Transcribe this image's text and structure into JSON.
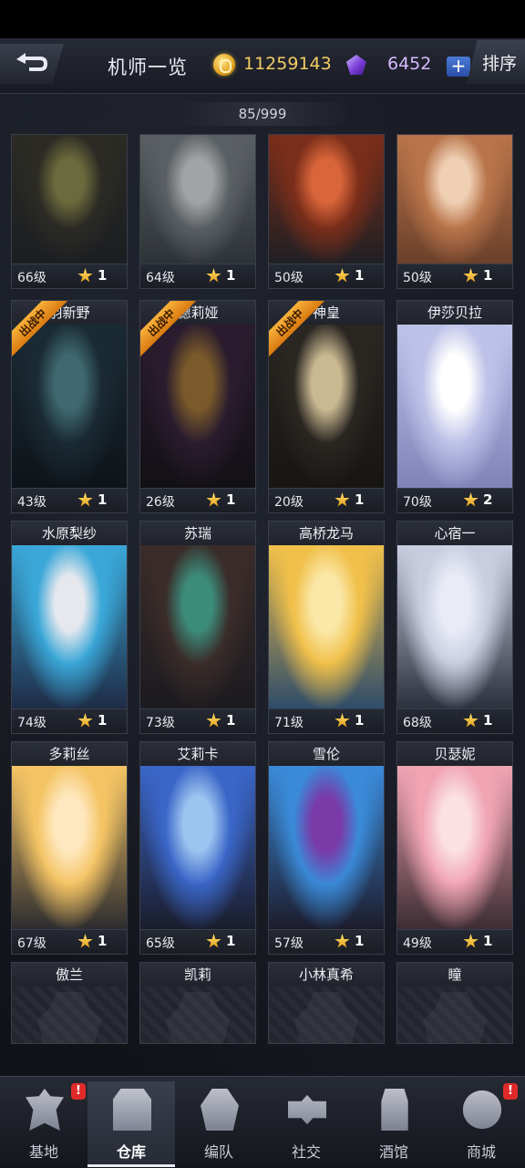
{
  "header": {
    "title": "机师一览",
    "coins": "11259143",
    "gems": "6452",
    "plus_label": "+",
    "sort_label": "排序"
  },
  "roster_count": "85/999",
  "badge_text": "出战中",
  "cards": [
    {
      "name": "",
      "level": "66级",
      "stars": "1",
      "deployed": false,
      "palette": [
        "#2b2a24",
        "#6b6a3c",
        "#1b1d22"
      ]
    },
    {
      "name": "",
      "level": "64级",
      "stars": "1",
      "deployed": false,
      "palette": [
        "#5a5f63",
        "#a0a4a6",
        "#2d3236"
      ]
    },
    {
      "name": "",
      "level": "50级",
      "stars": "1",
      "deployed": false,
      "palette": [
        "#7a2e1a",
        "#d9653a",
        "#1e1f24"
      ]
    },
    {
      "name": "",
      "level": "50级",
      "stars": "1",
      "deployed": false,
      "palette": [
        "#b8744a",
        "#f0d0b4",
        "#6a3f2a"
      ]
    },
    {
      "name": "羽新野",
      "level": "43级",
      "stars": "1",
      "deployed": true,
      "palette": [
        "#1a2a33",
        "#3f6870",
        "#0e1419"
      ]
    },
    {
      "name": "德莉娅",
      "level": "26级",
      "stars": "1",
      "deployed": true,
      "palette": [
        "#2a1c2e",
        "#7a5a2a",
        "#121015"
      ]
    },
    {
      "name": "神皇",
      "level": "20级",
      "stars": "1",
      "deployed": true,
      "palette": [
        "#2a2622",
        "#c9b890",
        "#171512"
      ]
    },
    {
      "name": "伊莎贝拉",
      "level": "70级",
      "stars": "2",
      "deployed": false,
      "palette": [
        "#bfc2e8",
        "#ffffff",
        "#7f82b8"
      ]
    },
    {
      "name": "水原梨纱",
      "level": "74级",
      "stars": "1",
      "deployed": false,
      "palette": [
        "#3aa7d8",
        "#e6e8ee",
        "#1e2a44"
      ]
    },
    {
      "name": "苏瑞",
      "level": "73级",
      "stars": "1",
      "deployed": false,
      "palette": [
        "#3a2c2a",
        "#3c8c7a",
        "#1b1a1f"
      ]
    },
    {
      "name": "高桥龙马",
      "level": "71级",
      "stars": "1",
      "deployed": false,
      "palette": [
        "#f0c04a",
        "#fbe8a8",
        "#2b4a6a"
      ]
    },
    {
      "name": "心宿一",
      "level": "68级",
      "stars": "1",
      "deployed": false,
      "palette": [
        "#c8cde0",
        "#e9ecf6",
        "#2a2e3a"
      ]
    },
    {
      "name": "多莉丝",
      "level": "67级",
      "stars": "1",
      "deployed": false,
      "palette": [
        "#f4c464",
        "#ffe8c0",
        "#2a2a2e"
      ]
    },
    {
      "name": "艾莉卡",
      "level": "65级",
      "stars": "1",
      "deployed": false,
      "palette": [
        "#3a66c8",
        "#9cc4f0",
        "#1a1c2a"
      ]
    },
    {
      "name": "雪伦",
      "level": "57级",
      "stars": "1",
      "deployed": false,
      "palette": [
        "#3a8ad8",
        "#7a3aa8",
        "#1c1a2a"
      ]
    },
    {
      "name": "贝瑟妮",
      "level": "49级",
      "stars": "1",
      "deployed": false,
      "palette": [
        "#f0a4b4",
        "#fbe0e4",
        "#3a2a30"
      ]
    }
  ],
  "locked_cards": [
    "傲兰",
    "凯莉",
    "小林真希",
    "瞳"
  ],
  "nav": [
    {
      "label": "基地",
      "alert": "!",
      "icon": "base-icon"
    },
    {
      "label": "仓库",
      "alert": "",
      "icon": "warehouse-icon"
    },
    {
      "label": "编队",
      "alert": "",
      "icon": "formation-icon"
    },
    {
      "label": "社交",
      "alert": "",
      "icon": "social-icon"
    },
    {
      "label": "酒馆",
      "alert": "",
      "icon": "tavern-icon"
    },
    {
      "label": "商城",
      "alert": "!",
      "icon": "shop-icon"
    }
  ]
}
